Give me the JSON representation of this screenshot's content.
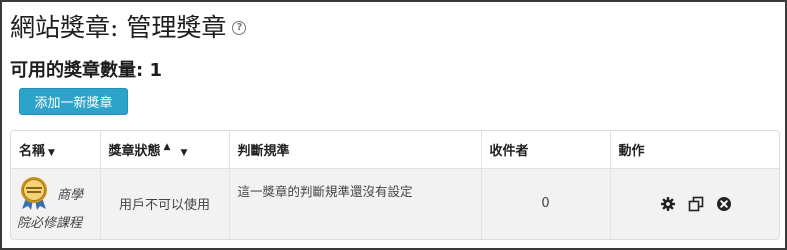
{
  "page": {
    "title": "網站獎章: 管理獎章",
    "available_label": "可用的獎章數量:",
    "available_count": "1",
    "add_button": "添加一新獎章"
  },
  "table": {
    "headers": {
      "name": "名稱",
      "status": "獎章狀態",
      "criteria": "判斷規準",
      "recipients": "收件者",
      "actions": "動作"
    },
    "rows": [
      {
        "badge_name_line1": "商學",
        "badge_name_line2": "院必修課程",
        "status": "用戶不可以使用",
        "criteria": "這一獎章的判斷規準還沒有設定",
        "recipients": "0"
      }
    ]
  },
  "icons": {
    "help": "help-icon",
    "sort_down": "caret-down-icon",
    "sort_up": "caret-up-icon",
    "settings": "gear-icon",
    "copy": "copy-icon",
    "delete": "delete-icon",
    "badge": "badge-medal-icon"
  },
  "colors": {
    "add_button_bg": "#2ea3c9",
    "row_bg": "#f2f2f2",
    "badge_gold": "#d4a017"
  }
}
